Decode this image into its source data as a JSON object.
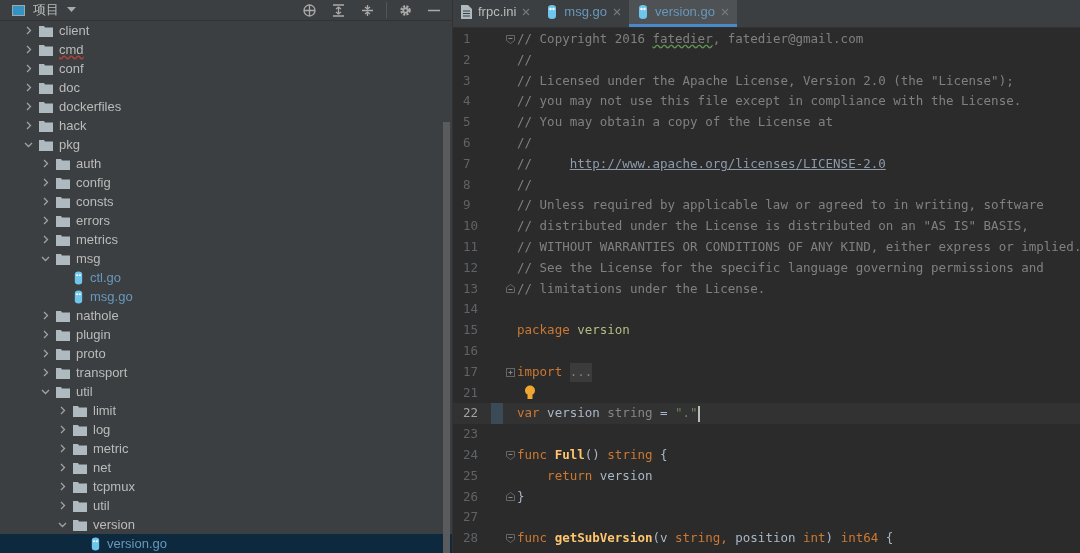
{
  "project_panel": {
    "title": "项目",
    "tree": [
      {
        "label": "client",
        "kind": "folder",
        "expanded": false
      },
      {
        "label": "cmd",
        "kind": "folder",
        "expanded": false,
        "flagged": true
      },
      {
        "label": "conf",
        "kind": "folder",
        "expanded": false
      },
      {
        "label": "doc",
        "kind": "folder",
        "expanded": false
      },
      {
        "label": "dockerfiles",
        "kind": "folder",
        "expanded": false
      },
      {
        "label": "hack",
        "kind": "folder",
        "expanded": false
      },
      {
        "label": "pkg",
        "kind": "folder",
        "expanded": true,
        "children": [
          {
            "label": "auth",
            "kind": "folder",
            "expanded": false
          },
          {
            "label": "config",
            "kind": "folder",
            "expanded": false
          },
          {
            "label": "consts",
            "kind": "folder",
            "expanded": false
          },
          {
            "label": "errors",
            "kind": "folder",
            "expanded": false
          },
          {
            "label": "metrics",
            "kind": "folder",
            "expanded": false
          },
          {
            "label": "msg",
            "kind": "folder",
            "expanded": true,
            "children": [
              {
                "label": "ctl.go",
                "kind": "go-file",
                "selected": false
              },
              {
                "label": "msg.go",
                "kind": "go-file",
                "selected": false
              }
            ]
          },
          {
            "label": "nathole",
            "kind": "folder",
            "expanded": false
          },
          {
            "label": "plugin",
            "kind": "folder",
            "expanded": false
          },
          {
            "label": "proto",
            "kind": "folder",
            "expanded": false
          },
          {
            "label": "transport",
            "kind": "folder",
            "expanded": false
          },
          {
            "label": "util",
            "kind": "folder",
            "expanded": true,
            "children": [
              {
                "label": "limit",
                "kind": "folder",
                "expanded": false
              },
              {
                "label": "log",
                "kind": "folder",
                "expanded": false
              },
              {
                "label": "metric",
                "kind": "folder",
                "expanded": false
              },
              {
                "label": "net",
                "kind": "folder",
                "expanded": false
              },
              {
                "label": "tcpmux",
                "kind": "folder",
                "expanded": false
              },
              {
                "label": "util",
                "kind": "folder",
                "expanded": false
              },
              {
                "label": "version",
                "kind": "folder",
                "expanded": true,
                "children": [
                  {
                    "label": "version.go",
                    "kind": "go-file",
                    "selected": true
                  }
                ]
              }
            ]
          }
        ]
      }
    ]
  },
  "tabs": [
    {
      "label": "frpc.ini",
      "kind": "text-file",
      "selected": false
    },
    {
      "label": "msg.go",
      "kind": "go-file",
      "selected": false
    },
    {
      "label": "version.go",
      "kind": "go-file",
      "selected": true
    }
  ],
  "editor": {
    "lines": [
      {
        "number": "1",
        "kind": "fold-start",
        "tokens": [
          {
            "text": "// Copyright 2016 ",
            "kind": "comment"
          },
          {
            "text": "fatedier",
            "kind": "comment",
            "flagged": true
          },
          {
            "text": ", fatedier@gmail.com",
            "kind": "comment"
          }
        ]
      },
      {
        "number": "2",
        "kind": "code",
        "tokens": [
          {
            "text": "//",
            "kind": "comment"
          }
        ]
      },
      {
        "number": "3",
        "kind": "code",
        "tokens": [
          {
            "text": "// Licensed under the Apache License, Version 2.0 (the \"License\");",
            "kind": "comment"
          }
        ]
      },
      {
        "number": "4",
        "kind": "code",
        "tokens": [
          {
            "text": "// you may not use this file except in compliance with the License.",
            "kind": "comment"
          }
        ]
      },
      {
        "number": "5",
        "kind": "code",
        "tokens": [
          {
            "text": "// You may obtain a copy of the License at",
            "kind": "comment"
          }
        ]
      },
      {
        "number": "6",
        "kind": "code",
        "tokens": [
          {
            "text": "//",
            "kind": "comment"
          }
        ]
      },
      {
        "number": "7",
        "kind": "code",
        "tokens": [
          {
            "text": "//     ",
            "kind": "comment"
          },
          {
            "text": "http://www.apache.org/licenses/LICENSE-2.0",
            "kind": "link"
          }
        ]
      },
      {
        "number": "8",
        "kind": "code",
        "tokens": [
          {
            "text": "//",
            "kind": "comment"
          }
        ]
      },
      {
        "number": "9",
        "kind": "code",
        "tokens": [
          {
            "text": "// Unless required by applicable law or agreed to in writing, software",
            "kind": "comment"
          }
        ]
      },
      {
        "number": "10",
        "kind": "code",
        "tokens": [
          {
            "text": "// distributed under the License is distributed on an \"AS IS\" BASIS,",
            "kind": "comment"
          }
        ]
      },
      {
        "number": "11",
        "kind": "code",
        "tokens": [
          {
            "text": "// WITHOUT WARRANTIES OR CONDITIONS OF ANY KIND, either express or implied.",
            "kind": "comment"
          }
        ]
      },
      {
        "number": "12",
        "kind": "code",
        "tokens": [
          {
            "text": "// See the License for the specific language governing permissions and",
            "kind": "comment"
          }
        ]
      },
      {
        "number": "13",
        "kind": "fold-end",
        "tokens": [
          {
            "text": "// limitations under the License.",
            "kind": "comment"
          }
        ]
      },
      {
        "number": "14",
        "kind": "code"
      },
      {
        "number": "15",
        "kind": "code",
        "tokens": [
          {
            "text": "package ",
            "kind": "keyword"
          },
          {
            "text": "version",
            "kind": "package"
          }
        ]
      },
      {
        "number": "16",
        "kind": "code"
      },
      {
        "number": "17",
        "kind": "folded",
        "tokens": [
          {
            "text": "import ",
            "kind": "keyword"
          },
          {
            "text": "...",
            "kind": "folded"
          }
        ]
      },
      {
        "number": "21",
        "kind": "code",
        "bulb": true
      },
      {
        "number": "22",
        "kind": "code",
        "current": true,
        "tokens": [
          {
            "text": "var",
            "kind": "keyword"
          },
          {
            "text": " version ",
            "kind": "plain"
          },
          {
            "text": "string",
            "kind": "muted"
          },
          {
            "text": " = ",
            "kind": "plain"
          },
          {
            "text": "\".\"",
            "kind": "string"
          }
        ]
      },
      {
        "number": "23",
        "kind": "code"
      },
      {
        "number": "24",
        "kind": "fold-start",
        "tokens": [
          {
            "text": "func ",
            "kind": "keyword"
          },
          {
            "text": "Full",
            "kind": "function"
          },
          {
            "text": "() ",
            "kind": "plain"
          },
          {
            "text": "string",
            "kind": "keyword"
          },
          {
            "text": " {",
            "kind": "plain"
          }
        ]
      },
      {
        "number": "25",
        "kind": "code",
        "tokens": [
          {
            "text": "    return",
            "kind": "keyword"
          },
          {
            "text": " version",
            "kind": "plain"
          }
        ]
      },
      {
        "number": "26",
        "kind": "fold-end",
        "tokens": [
          {
            "text": "}",
            "kind": "plain"
          }
        ]
      },
      {
        "number": "27",
        "kind": "code"
      },
      {
        "number": "28",
        "kind": "fold-start",
        "tokens": [
          {
            "text": "func ",
            "kind": "keyword"
          },
          {
            "text": "getSubVersion",
            "kind": "function"
          },
          {
            "text": "(v ",
            "kind": "plain"
          },
          {
            "text": "string,",
            "kind": "keyword"
          },
          {
            "text": " position ",
            "kind": "plain"
          },
          {
            "text": "int",
            "kind": "keyword"
          },
          {
            "text": ") ",
            "kind": "plain"
          },
          {
            "text": "int64",
            "kind": "keyword"
          },
          {
            "text": " {",
            "kind": "plain"
          }
        ]
      }
    ]
  }
}
